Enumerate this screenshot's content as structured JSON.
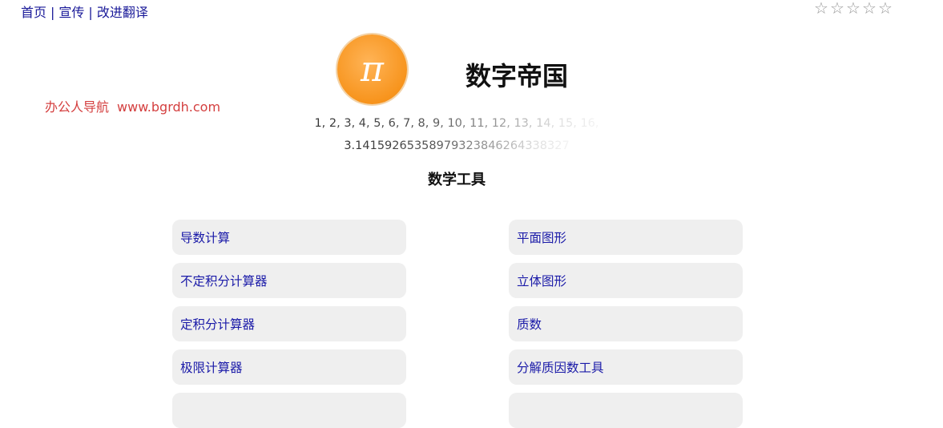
{
  "nav": {
    "home": "首页",
    "promo": "宣传",
    "translate": "改进翻译",
    "separator": "|"
  },
  "rating": {
    "stars": [
      "☆",
      "☆",
      "☆",
      "☆",
      "☆"
    ],
    "filled": 0
  },
  "logo": {
    "symbol": "π",
    "color": "#f7941d"
  },
  "site": {
    "title": "数字帝国"
  },
  "side_link": {
    "label": "办公人导航",
    "url": "www.bgrdh.com",
    "color": "#d43f3f"
  },
  "ticker": {
    "numbers": "1, 2, 3, 4, 5, 6, 7, 8, 9, 10, 11, 12, 13, 14, 15, 16,",
    "pi": "3.14159265358979323846264338327"
  },
  "section": {
    "title": "数学工具"
  },
  "tools": {
    "left": [
      "导数计算",
      "不定积分计算器",
      "定积分计算器",
      "极限计算器",
      ""
    ],
    "right": [
      "平面图形",
      "立体图形",
      "质数",
      "分解质因数工具",
      ""
    ]
  },
  "colors": {
    "link": "#1a1a99",
    "button_bg": "#efefef",
    "button_text": "#1a1aa8"
  }
}
